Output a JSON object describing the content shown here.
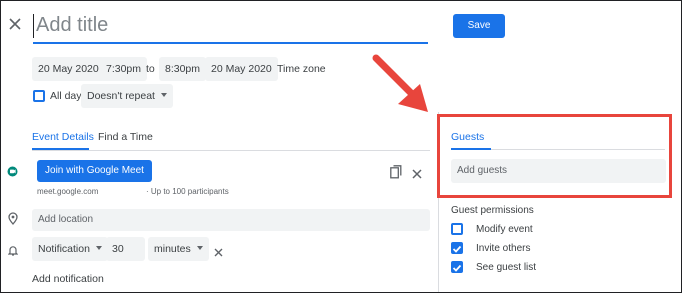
{
  "header": {
    "title_placeholder": "Add title",
    "save_label": "Save"
  },
  "datetime": {
    "start_date": "20 May 2020",
    "start_time": "7:30pm",
    "separator": "to",
    "end_time": "8:30pm",
    "end_date": "20 May 2020",
    "timezone_label": "Time zone",
    "all_day_label": "All day",
    "repeat_label": "Doesn't repeat"
  },
  "tabs": [
    {
      "label": "Event Details"
    },
    {
      "label": "Find a Time"
    }
  ],
  "meet": {
    "button_label": "Join with Google Meet",
    "link": "meet.google.com",
    "participants": "· Up to 100 participants"
  },
  "location": {
    "placeholder": "Add location"
  },
  "notification": {
    "type": "Notification",
    "value": "30",
    "unit": "minutes",
    "add_label": "Add notification"
  },
  "guests": {
    "tab_label": "Guests",
    "input_placeholder": "Add guests",
    "permissions_title": "Guest permissions",
    "permissions": [
      {
        "label": "Modify event",
        "checked": false
      },
      {
        "label": "Invite others",
        "checked": true
      },
      {
        "label": "See guest list",
        "checked": true
      }
    ]
  },
  "colors": {
    "accent": "#1a73e8",
    "highlight": "#e8453c",
    "field_bg": "#f1f3f4",
    "meet_green": "#00897b"
  }
}
